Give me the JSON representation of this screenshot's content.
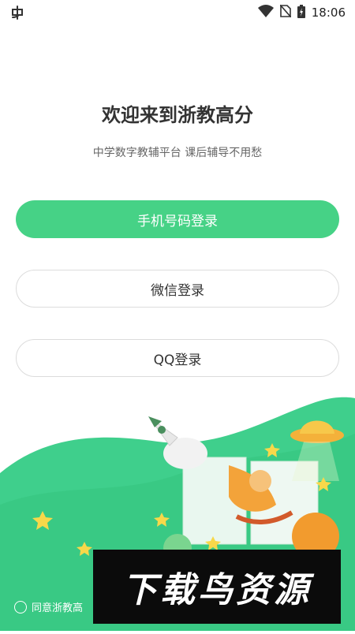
{
  "status_bar": {
    "time": "18:06",
    "left_icon": "app-notification-icon",
    "icons": [
      "wifi-icon",
      "no-sim-icon",
      "battery-charging-icon"
    ]
  },
  "header": {
    "title": "欢迎来到浙教高分",
    "subtitle": "中学数字教辅平台 课后辅导不用愁"
  },
  "buttons": {
    "phone_login": "手机号码登录",
    "wechat_login": "微信登录",
    "qq_login": "QQ登录"
  },
  "agreement": {
    "text": "同意浙教高"
  },
  "watermark": {
    "text": "下载鸟资源"
  },
  "colors": {
    "accent": "#46d286",
    "wave": "#3fcf8c",
    "outline": "#dcdcdc"
  }
}
